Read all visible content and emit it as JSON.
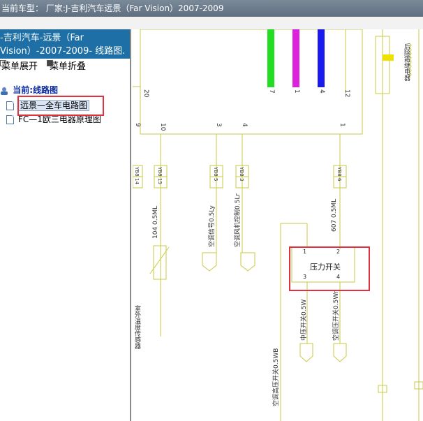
{
  "window": {
    "title_prefix": "当前车型：",
    "title": "厂家:J-吉利汽车远景（Far Vision）2007-2009"
  },
  "sidebar": {
    "doc_title_line1": "-吉利汽车-远景（Far",
    "doc_title_line2": "Vision）-2007-2009- 线路图.",
    "expand_label": "菜单展开",
    "collapse_label": "菜单折叠",
    "tree_root": "当前:线路图",
    "items": [
      {
        "label": "远景—全车电路图",
        "selected": true
      },
      {
        "label": "FC—1欧三电器原理图",
        "selected": false
      }
    ]
  },
  "diagram": {
    "wire_colors": [
      "#22dd22",
      "#dd22dd",
      "#1a1aee"
    ],
    "line_color": "#c9c945",
    "red_box_color": "#e0323c",
    "pin_top": [
      "20",
      "7",
      "1",
      "4",
      "12"
    ],
    "pin_bottom": [
      "9",
      "10",
      "3",
      "4",
      "1"
    ],
    "connectors": [
      {
        "top": "YB8",
        "bottom": "14"
      },
      {
        "top": "YB8",
        "bottom": "15"
      },
      {
        "top": "YB8",
        "bottom": "5"
      },
      {
        "top": "YB8",
        "bottom": "3"
      },
      {
        "top": "YB8",
        "bottom": "6"
      }
    ],
    "wire_labels": [
      "104 0.5ML",
      "空调信号0.5Ly",
      "空调风机控制0.5Lr",
      "607 0.5ML",
      "中压开关0.5W",
      "空调压开关0.5Wr",
      "空调高压开关0.5WB"
    ],
    "switch_label": "压力开关",
    "switch_pins": [
      "1",
      "2",
      "3",
      "4"
    ],
    "sensor_label": "室外温度传感器",
    "right_label": "后除霜继电器"
  }
}
